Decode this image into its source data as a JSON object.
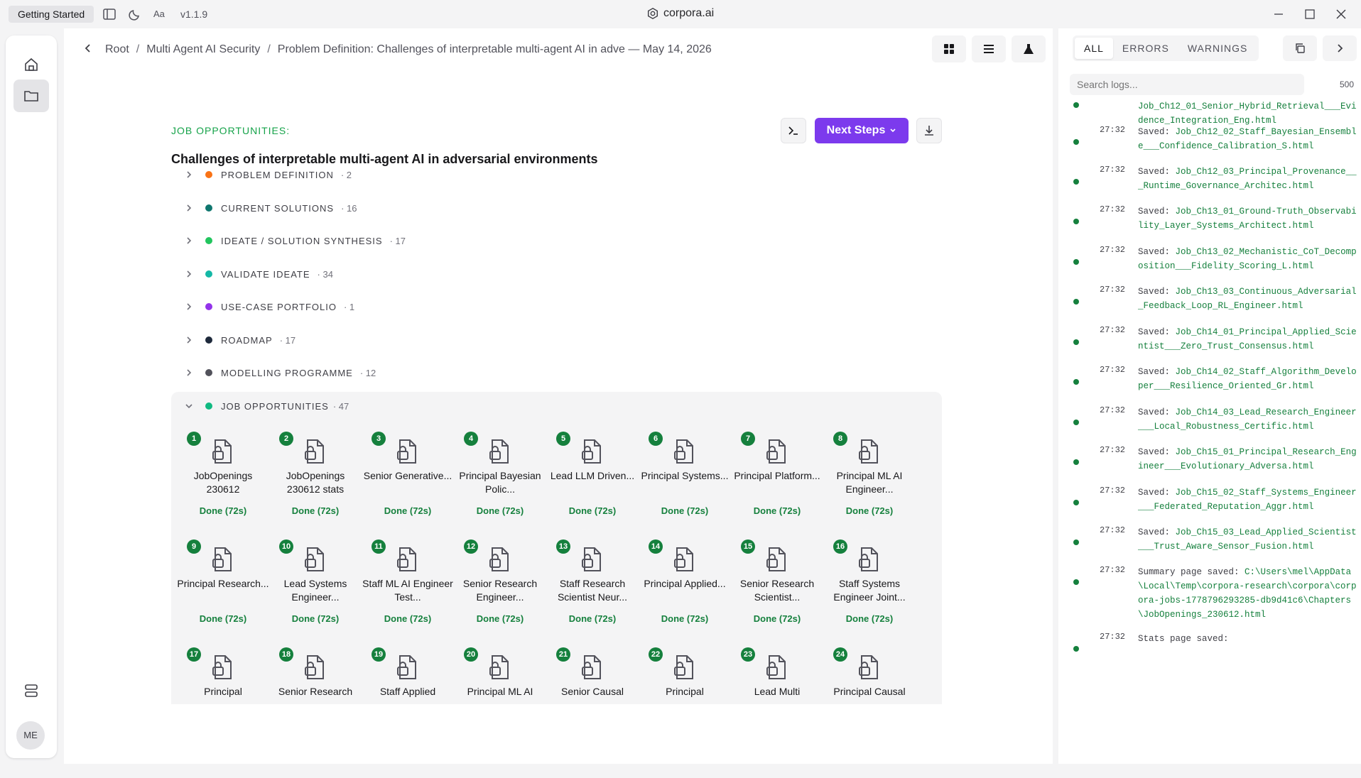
{
  "titlebar": {
    "getting_started": "Getting Started",
    "version": "v1.1.9",
    "app_title": "corpora.ai"
  },
  "breadcrumb": [
    "Root",
    "Multi Agent AI Security",
    "Problem Definition: Challenges of interpretable multi-agent AI in adve — May 14, 2026"
  ],
  "main": {
    "section_tag": "JOB OPPORTUNITIES:",
    "heading": "Challenges of interpretable multi-agent AI in adversarial environments",
    "next_steps_label": "Next Steps",
    "sections": [
      {
        "label": "PROBLEM DEFINITION",
        "count": "· 2",
        "color": "#f97316"
      },
      {
        "label": "CURRENT SOLUTIONS",
        "count": "· 16",
        "color": "#0f766e"
      },
      {
        "label": "IDEATE / SOLUTION SYNTHESIS",
        "count": "· 17",
        "color": "#22c55e"
      },
      {
        "label": "VALIDATE IDEATE",
        "count": "· 34",
        "color": "#14b8a6"
      },
      {
        "label": "USE-CASE PORTFOLIO",
        "count": "· 1",
        "color": "#9333ea"
      },
      {
        "label": "ROADMAP",
        "count": "· 17",
        "color": "#1e293b"
      },
      {
        "label": "MODELLING PROGRAMME",
        "count": "· 12",
        "color": "#52525b"
      }
    ],
    "jobs_section": {
      "label": "JOB OPPORTUNITIES",
      "count": "· 47",
      "color": "#10b981"
    },
    "jobs": [
      {
        "num": "1",
        "title": "JobOpenings 230612",
        "status": "Done (72s)"
      },
      {
        "num": "2",
        "title": "JobOpenings 230612 stats",
        "status": "Done (72s)"
      },
      {
        "num": "3",
        "title": "Senior Generative...",
        "status": "Done (72s)"
      },
      {
        "num": "4",
        "title": "Principal Bayesian Polic...",
        "status": "Done (72s)"
      },
      {
        "num": "5",
        "title": "Lead LLM Driven...",
        "status": "Done (72s)"
      },
      {
        "num": "6",
        "title": "Principal Systems...",
        "status": "Done (72s)"
      },
      {
        "num": "7",
        "title": "Principal Platform...",
        "status": "Done (72s)"
      },
      {
        "num": "8",
        "title": "Principal ML AI Engineer...",
        "status": "Done (72s)"
      },
      {
        "num": "9",
        "title": "Principal Research...",
        "status": "Done (72s)"
      },
      {
        "num": "10",
        "title": "Lead Systems Engineer...",
        "status": "Done (72s)"
      },
      {
        "num": "11",
        "title": "Staff ML AI Engineer Test...",
        "status": "Done (72s)"
      },
      {
        "num": "12",
        "title": "Senior Research Engineer...",
        "status": "Done (72s)"
      },
      {
        "num": "13",
        "title": "Staff Research Scientist Neur...",
        "status": "Done (72s)"
      },
      {
        "num": "14",
        "title": "Principal Applied...",
        "status": "Done (72s)"
      },
      {
        "num": "15",
        "title": "Senior Research Scientist...",
        "status": "Done (72s)"
      },
      {
        "num": "16",
        "title": "Staff Systems Engineer Joint...",
        "status": "Done (72s)"
      },
      {
        "num": "17",
        "title": "Principal",
        "status": ""
      },
      {
        "num": "18",
        "title": "Senior Research",
        "status": ""
      },
      {
        "num": "19",
        "title": "Staff Applied",
        "status": ""
      },
      {
        "num": "20",
        "title": "Principal ML AI",
        "status": ""
      },
      {
        "num": "21",
        "title": "Senior Causal",
        "status": ""
      },
      {
        "num": "22",
        "title": "Principal",
        "status": ""
      },
      {
        "num": "23",
        "title": "Lead Multi",
        "status": ""
      },
      {
        "num": "24",
        "title": "Principal Causal",
        "status": ""
      }
    ]
  },
  "sidebar": {
    "avatar": "ME"
  },
  "logs": {
    "tabs": [
      "ALL",
      "ERRORS",
      "WARNINGS"
    ],
    "search_placeholder": "Search logs...",
    "count": "500",
    "entries": [
      {
        "time": "",
        "label": "",
        "msg": "Job_Ch12_01_Senior_Hybrid_Retrieval___Evidence_Integration_Eng.html"
      },
      {
        "time": "27:32",
        "label": "Saved:",
        "msg": "Job_Ch12_02_Staff_Bayesian_Ensemble___Confidence_Calibration_S.html"
      },
      {
        "time": "27:32",
        "label": "Saved:",
        "msg": "Job_Ch12_03_Principal_Provenance___Runtime_Governance_Architec.html"
      },
      {
        "time": "27:32",
        "label": "Saved:",
        "msg": "Job_Ch13_01_Ground-Truth_Observability_Layer_Systems_Architect.html"
      },
      {
        "time": "27:32",
        "label": "Saved:",
        "msg": "Job_Ch13_02_Mechanistic_CoT_Decomposition___Fidelity_Scoring_L.html"
      },
      {
        "time": "27:32",
        "label": "Saved:",
        "msg": "Job_Ch13_03_Continuous_Adversarial_Feedback_Loop_RL_Engineer.html"
      },
      {
        "time": "27:32",
        "label": "Saved:",
        "msg": "Job_Ch14_01_Principal_Applied_Scientist___Zero_Trust_Consensus.html"
      },
      {
        "time": "27:32",
        "label": "Saved:",
        "msg": "Job_Ch14_02_Staff_Algorithm_Developer___Resilience_Oriented_Gr.html"
      },
      {
        "time": "27:32",
        "label": "Saved:",
        "msg": "Job_Ch14_03_Lead_Research_Engineer___Local_Robustness_Certific.html"
      },
      {
        "time": "27:32",
        "label": "Saved:",
        "msg": "Job_Ch15_01_Principal_Research_Engineer___Evolutionary_Adversa.html"
      },
      {
        "time": "27:32",
        "label": "Saved:",
        "msg": "Job_Ch15_02_Staff_Systems_Engineer___Federated_Reputation_Aggr.html"
      },
      {
        "time": "27:32",
        "label": "Saved:",
        "msg": "Job_Ch15_03_Lead_Applied_Scientist___Trust_Aware_Sensor_Fusion.html"
      },
      {
        "time": "27:32",
        "label": "Summary page saved:",
        "msg": "C:\\Users\\mel\\AppData\\Local\\Temp\\corpora-research\\corpora\\corpora-jobs-1778796293285-db9d41c6\\Chapters\\JobOpenings_230612.html"
      },
      {
        "time": "27:32",
        "label": "Stats page saved:",
        "msg": ""
      }
    ]
  }
}
